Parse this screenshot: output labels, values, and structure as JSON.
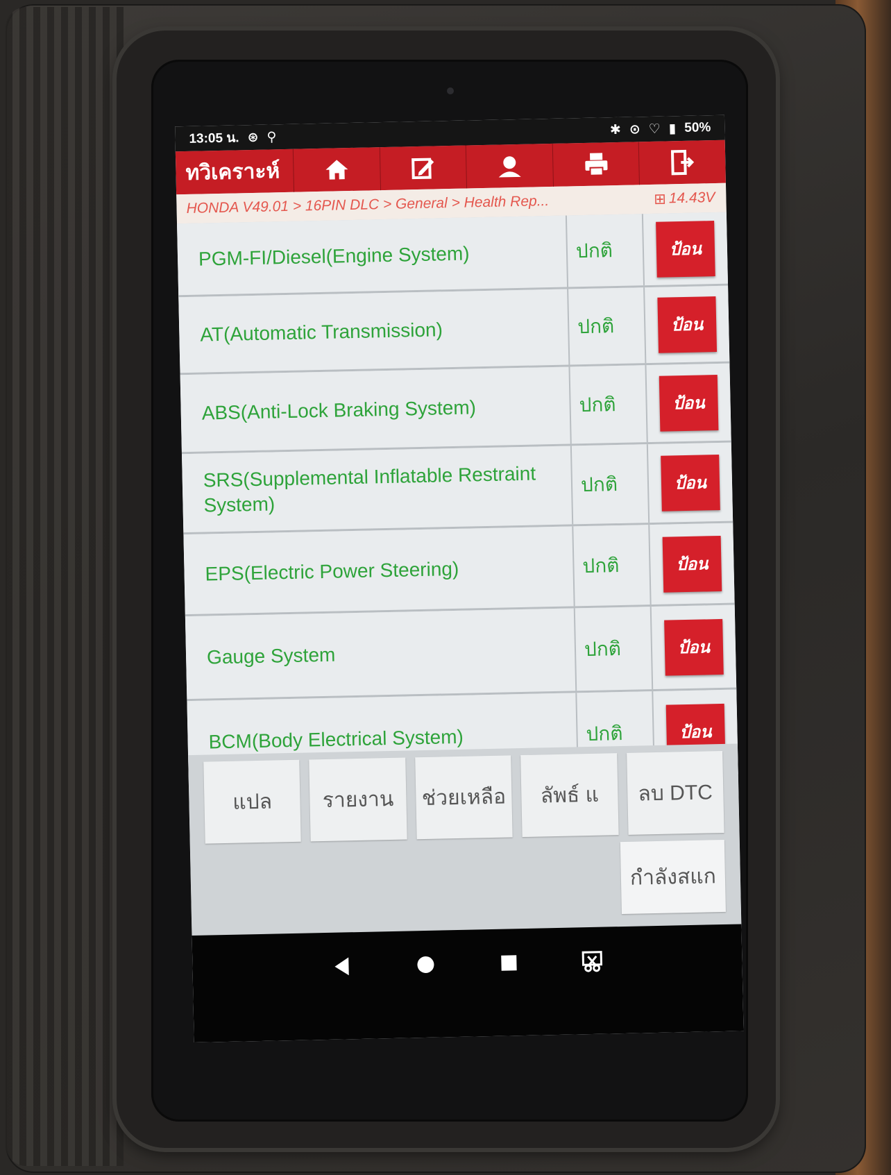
{
  "statusbar": {
    "time": "13:05 น.",
    "battery": "50%"
  },
  "toolbar": {
    "title": "ทวิเคราะห์",
    "icons": [
      "home-icon",
      "edit-icon",
      "user-icon",
      "print-icon",
      "exit-icon"
    ]
  },
  "breadcrumb": {
    "path": "HONDA V49.01 > 16PIN DLC > General > Health Rep...",
    "voltage": "14.43V"
  },
  "systems": [
    {
      "name": "PGM-FI/Diesel(Engine System)",
      "status": "ปกติ",
      "action": "ป้อน"
    },
    {
      "name": "AT(Automatic Transmission)",
      "status": "ปกติ",
      "action": "ป้อน"
    },
    {
      "name": "ABS(Anti-Lock Braking System)",
      "status": "ปกติ",
      "action": "ป้อน"
    },
    {
      "name": "SRS(Supplemental Inflatable Restraint System)",
      "status": "ปกติ",
      "action": "ป้อน"
    },
    {
      "name": "EPS(Electric Power Steering)",
      "status": "ปกติ",
      "action": "ป้อน"
    },
    {
      "name": "Gauge System",
      "status": "ปกติ",
      "action": "ป้อน"
    },
    {
      "name": "BCM(Body Electrical System)",
      "status": "ปกติ",
      "action": "ป้อน"
    }
  ],
  "buttons": {
    "translate": "แปล",
    "report": "รายงาน",
    "help": "ช่วยเหลือ",
    "terms": "ลัพธ์ แ",
    "clear_dtc": "ลบ DTC",
    "scanning": "กำลังสแก"
  },
  "colors": {
    "accent_red": "#c51d24",
    "ok_green": "#2ea33a"
  }
}
